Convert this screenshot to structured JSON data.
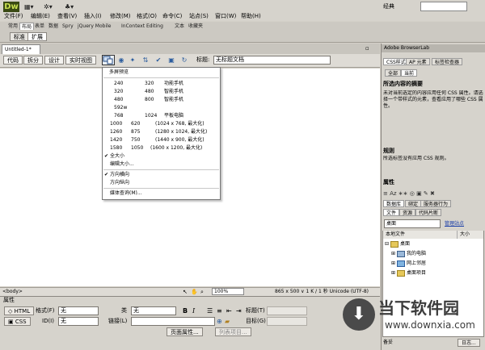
{
  "app": {
    "logo": "Dw",
    "workspace": "经典",
    "menus": [
      "文件(F)",
      "编辑(E)",
      "查看(V)",
      "插入(I)",
      "修改(M)",
      "格式(O)",
      "命令(C)",
      "站点(S)",
      "窗口(W)",
      "帮助(H)"
    ]
  },
  "insert_bar": {
    "tabs": [
      "常用",
      "布局",
      "表单",
      "数据",
      "Spry",
      "jQuery Mobile",
      "InContext Editing",
      "文本",
      "收藏夹"
    ],
    "active_tab": "布局",
    "sub_tabs": [
      "标准",
      "扩展"
    ],
    "active_sub": "扩展"
  },
  "document": {
    "tab_label": "Untitled-1*",
    "view_buttons": [
      "代码",
      "拆分",
      "设计",
      "实时视图"
    ],
    "title_label": "标题:",
    "title_value": "无标题文档"
  },
  "preview_menu": {
    "header": "多屏预览",
    "sizes": [
      {
        "w": "240",
        "h": "320",
        "label": "功能手机"
      },
      {
        "w": "320",
        "h": "480",
        "label": "智能手机"
      },
      {
        "w": "480",
        "h": "800",
        "label": "智能手机"
      },
      {
        "w": "592w",
        "h": "",
        "label": ""
      },
      {
        "w": "768",
        "h": "1024",
        "label": "平板电脑"
      },
      {
        "w": "1000",
        "h": "620",
        "label": "(1024 x 768, 最大化)"
      },
      {
        "w": "1260",
        "h": "875",
        "label": "(1280 x 1024, 最大化)"
      },
      {
        "w": "1420",
        "h": "750",
        "label": "(1440 x 900, 最大化)"
      },
      {
        "w": "1580",
        "h": "1050",
        "label": "(1600 x 1200, 最大化)"
      }
    ],
    "full_size": "全大小",
    "edit_sizes": "编辑大小...",
    "orient_landscape": "方向横向",
    "orient_portrait": "方向纵向",
    "media_query": "媒体查询(M)..."
  },
  "status_bar": {
    "tag": "<body>",
    "zoom": "100%",
    "info": "865 x 500 ∨  1 K / 1 秒  Unicode (UTF-8)"
  },
  "properties": {
    "title": "属性",
    "html_btn": "HTML",
    "css_btn": "CSS",
    "format_label": "格式(F)",
    "format_value": "无",
    "class_label": "类",
    "class_value": "无",
    "id_label": "ID(I)",
    "id_value": "无",
    "link_label": "链接(L)",
    "title_label": "标题(T)",
    "target_label": "目标(G)",
    "page_props": "页面属性...",
    "list_item": "列表项目..."
  },
  "right_panel": {
    "browserlab": "Adobe BrowserLab",
    "css_tabs": [
      "CSS样式",
      "AP 元素",
      "标签检查器"
    ],
    "css_subtabs": [
      "全部",
      "当前"
    ],
    "summary_title": "所选内容的摘要",
    "summary_text": "未对当前选定的内容应用任何 CSS 属性。请选择一个带样式的元素，查看应用了哪些 CSS 属性。",
    "rules_title": "规则",
    "rules_text": "所选标签没有应用 CSS 规则。",
    "props_title": "属性",
    "db_tabs": [
      "数据库",
      "绑定",
      "服务器行为"
    ],
    "file_tabs": [
      "文件",
      "资源",
      "代码片断"
    ],
    "site_select": "桌面",
    "manage_sites": "管理站点",
    "col_local": "本地文件",
    "col_size": "大小",
    "tree": [
      "桌面",
      "我的电脑",
      "网上邻居",
      "桌面项目"
    ],
    "log_btn": "日志...",
    "ready": "备妥"
  },
  "watermark": {
    "title": "当下软件园",
    "url": "www.downxia.com",
    "icon": "download-arrow-icon"
  }
}
